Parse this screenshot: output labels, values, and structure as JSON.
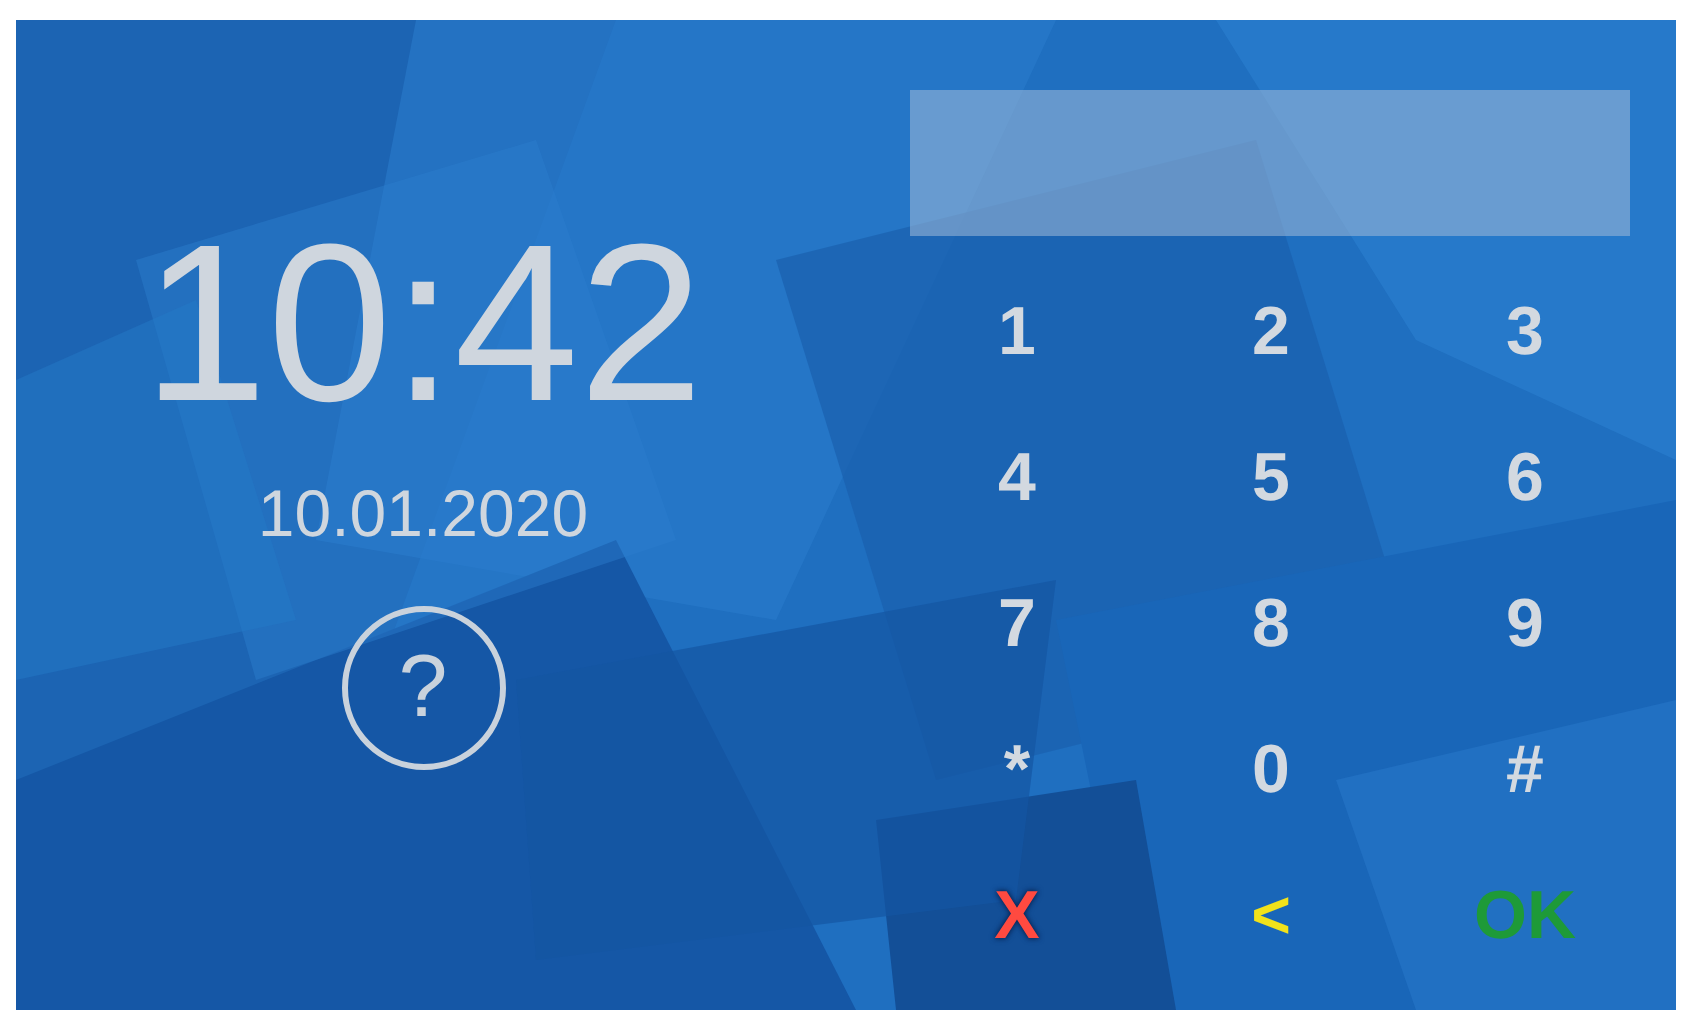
{
  "clock": {
    "time": "10:42",
    "date": "10.01.2020"
  },
  "help": {
    "label": "?"
  },
  "keypad": {
    "keys": [
      {
        "label": "1",
        "kind": "digit"
      },
      {
        "label": "2",
        "kind": "digit"
      },
      {
        "label": "3",
        "kind": "digit"
      },
      {
        "label": "4",
        "kind": "digit"
      },
      {
        "label": "5",
        "kind": "digit"
      },
      {
        "label": "6",
        "kind": "digit"
      },
      {
        "label": "7",
        "kind": "digit"
      },
      {
        "label": "8",
        "kind": "digit"
      },
      {
        "label": "9",
        "kind": "digit"
      },
      {
        "label": "*",
        "kind": "digit"
      },
      {
        "label": "0",
        "kind": "digit"
      },
      {
        "label": "#",
        "kind": "digit"
      },
      {
        "label": "X",
        "kind": "cancel"
      },
      {
        "label": "<",
        "kind": "back"
      },
      {
        "label": "OK",
        "kind": "ok"
      }
    ]
  }
}
